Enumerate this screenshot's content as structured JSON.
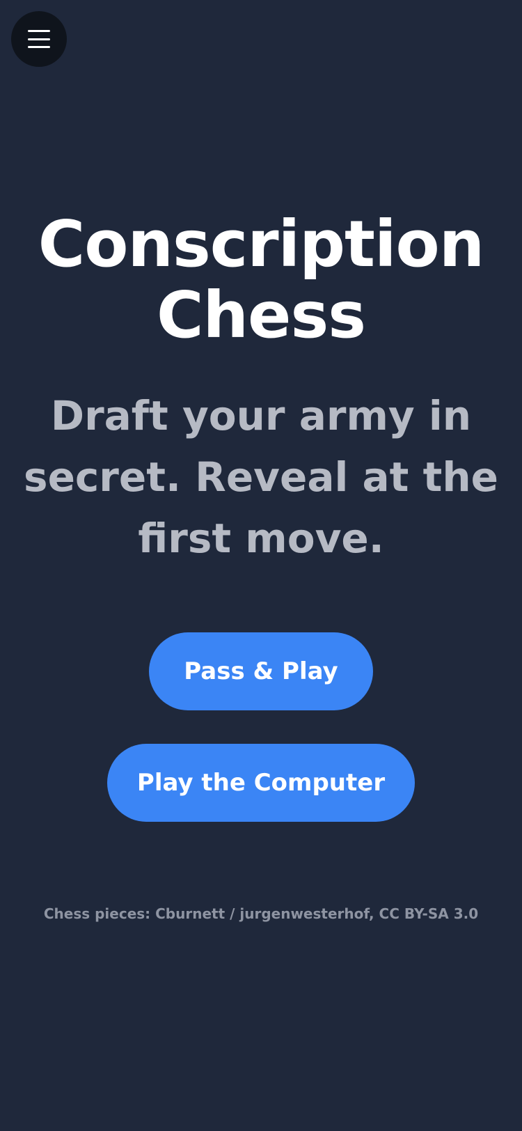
{
  "menu": {
    "icon": "hamburger-menu-icon"
  },
  "hero": {
    "title_lines": [
      "Conscription",
      "Chess"
    ],
    "subtitle_lines": [
      "Draft your army in",
      "secret. Reveal at the",
      "first move."
    ]
  },
  "actions": {
    "pass_and_play_label": "Pass & Play",
    "play_computer_label": "Play the Computer"
  },
  "footer": {
    "credits": "Chess pieces: Cburnett / jurgenwesterhof, CC BY-SA 3.0"
  },
  "colors": {
    "background": "#1f283b",
    "menu_button": "#0f141c",
    "accent": "#3b85f5",
    "title": "#ffffff",
    "subtitle": "#b6bac4",
    "credits": "#8e94a2"
  }
}
